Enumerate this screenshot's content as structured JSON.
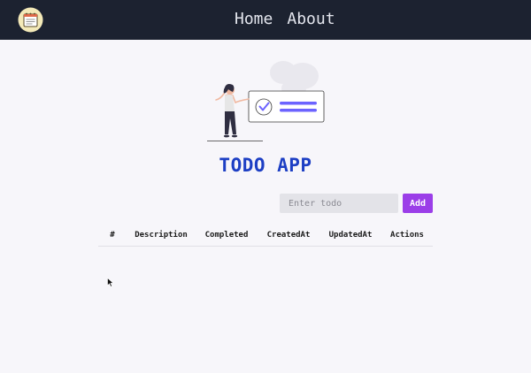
{
  "navbar": {
    "logo_icon": "notepad-logo-icon",
    "links": [
      {
        "label": "Home"
      },
      {
        "label": "About"
      }
    ]
  },
  "hero": {
    "illustration": "woman-checklist-illustration",
    "title": "TODO APP"
  },
  "form": {
    "input_placeholder": "Enter todo",
    "input_value": "",
    "add_label": "Add"
  },
  "table": {
    "columns": [
      "#",
      "Description",
      "Completed",
      "CreatedAt",
      "UpdatedAt",
      "Actions"
    ],
    "rows": []
  },
  "colors": {
    "navbar_bg": "#1c2230",
    "title": "#1d3fc4",
    "accent": "#9b3ee8",
    "illustration_accent": "#6c63ff"
  }
}
